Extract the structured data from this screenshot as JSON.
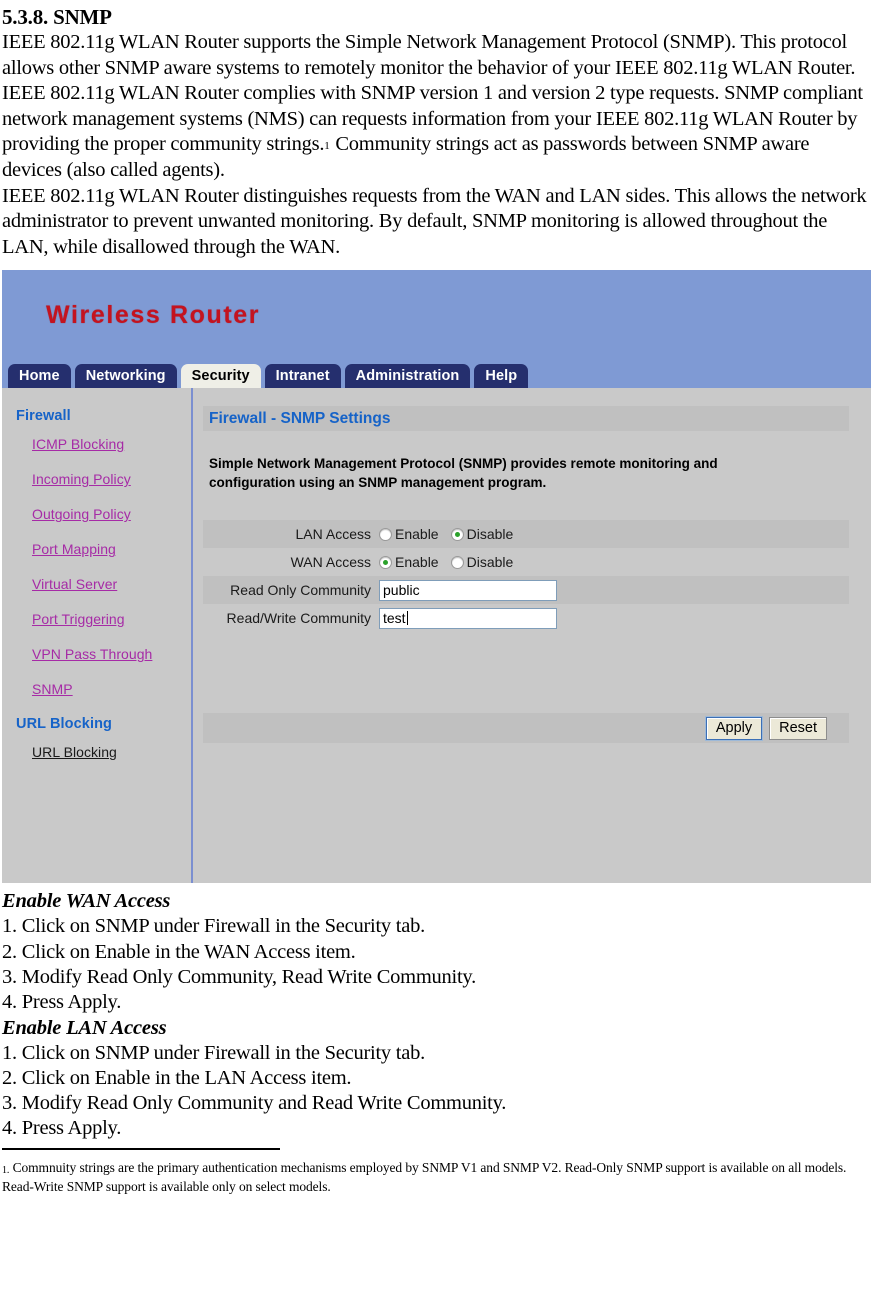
{
  "document": {
    "section_heading": "5.3.8. SNMP",
    "paragraph_1": "IEEE 802.11g WLAN Router supports the Simple Network Management Protocol (SNMP). This protocol allows other SNMP aware systems to remotely monitor the behavior of your IEEE 802.11g WLAN Router. IEEE 802.11g WLAN Router complies with SNMP version 1 and version 2 type requests. SNMP compliant network management systems (NMS) can requests information from your IEEE 802.11g WLAN Router by providing the proper community strings.",
    "footnote_marker": "1",
    "paragraph_1_cont": "Community strings act as passwords between SNMP aware devices (also called agents).",
    "paragraph_2": "IEEE 802.11g WLAN Router distinguishes requests from the WAN and LAN sides. This allows the network administrator to prevent unwanted monitoring. By default, SNMP monitoring is allowed throughout the LAN, while disallowed through the WAN.",
    "wan_steps_heading": "Enable WAN Access",
    "wan_steps": [
      "1. Click on SNMP under Firewall in the Security tab.",
      "2. Click on Enable in the WAN Access item.",
      "3. Modify Read Only Community, Read Write Community.",
      "4. Press Apply."
    ],
    "lan_steps_heading": "Enable LAN Access",
    "lan_steps": [
      "1. Click on SNMP under Firewall in the Security tab.",
      "2. Click on Enable in the LAN Access item.",
      "3. Modify Read Only Community and Read Write Community.",
      "4. Press Apply."
    ],
    "footnote_number": "1.",
    "footnote_text": "Commnuity strings are the primary authentication mechanisms employed by SNMP V1 and SNMP V2. Read-Only SNMP support is available on all models. Read-Write SNMP support is available only on select models."
  },
  "screenshot": {
    "brand": "Wireless Router",
    "tabs": [
      {
        "label": "Home",
        "active": false
      },
      {
        "label": "Networking",
        "active": false
      },
      {
        "label": "Security",
        "active": true
      },
      {
        "label": "Intranet",
        "active": false
      },
      {
        "label": "Administration",
        "active": false
      },
      {
        "label": "Help",
        "active": false
      }
    ],
    "sidebar": {
      "group1_heading": "Firewall",
      "group1_links": [
        "ICMP Blocking",
        "Incoming Policy",
        "Outgoing Policy",
        "Port Mapping",
        "Virtual Server",
        "Port Triggering",
        "VPN Pass Through",
        "SNMP"
      ],
      "group2_heading": "URL Blocking",
      "group2_links": [
        "URL Blocking"
      ]
    },
    "panel": {
      "title": "Firewall - SNMP Settings",
      "description": "Simple Network Management Protocol (SNMP) provides remote monitoring and configuration using an SNMP management program.",
      "rows": {
        "lan_label": "LAN Access",
        "wan_label": "WAN Access",
        "readonly_label": "Read Only Community",
        "readwrite_label": "Read/Write Community",
        "enable_label": "Enable",
        "disable_label": "Disable",
        "lan_selected": "Disable",
        "wan_selected": "Enable",
        "readonly_value": "public",
        "readwrite_value": "test"
      },
      "apply_label": "Apply",
      "reset_label": "Reset"
    },
    "colors": {
      "header_blue": "#7f9ad4",
      "brand_red": "#c4131f",
      "tab_navy": "#252f6e",
      "tab_active_bg": "#efefe7",
      "panel_gray": "#c9c9c9",
      "stripe_gray": "#c0c0c0",
      "link_purple": "#a62ba6",
      "heading_blue": "#1663c8",
      "radio_dot_green": "#2aa12a"
    }
  }
}
